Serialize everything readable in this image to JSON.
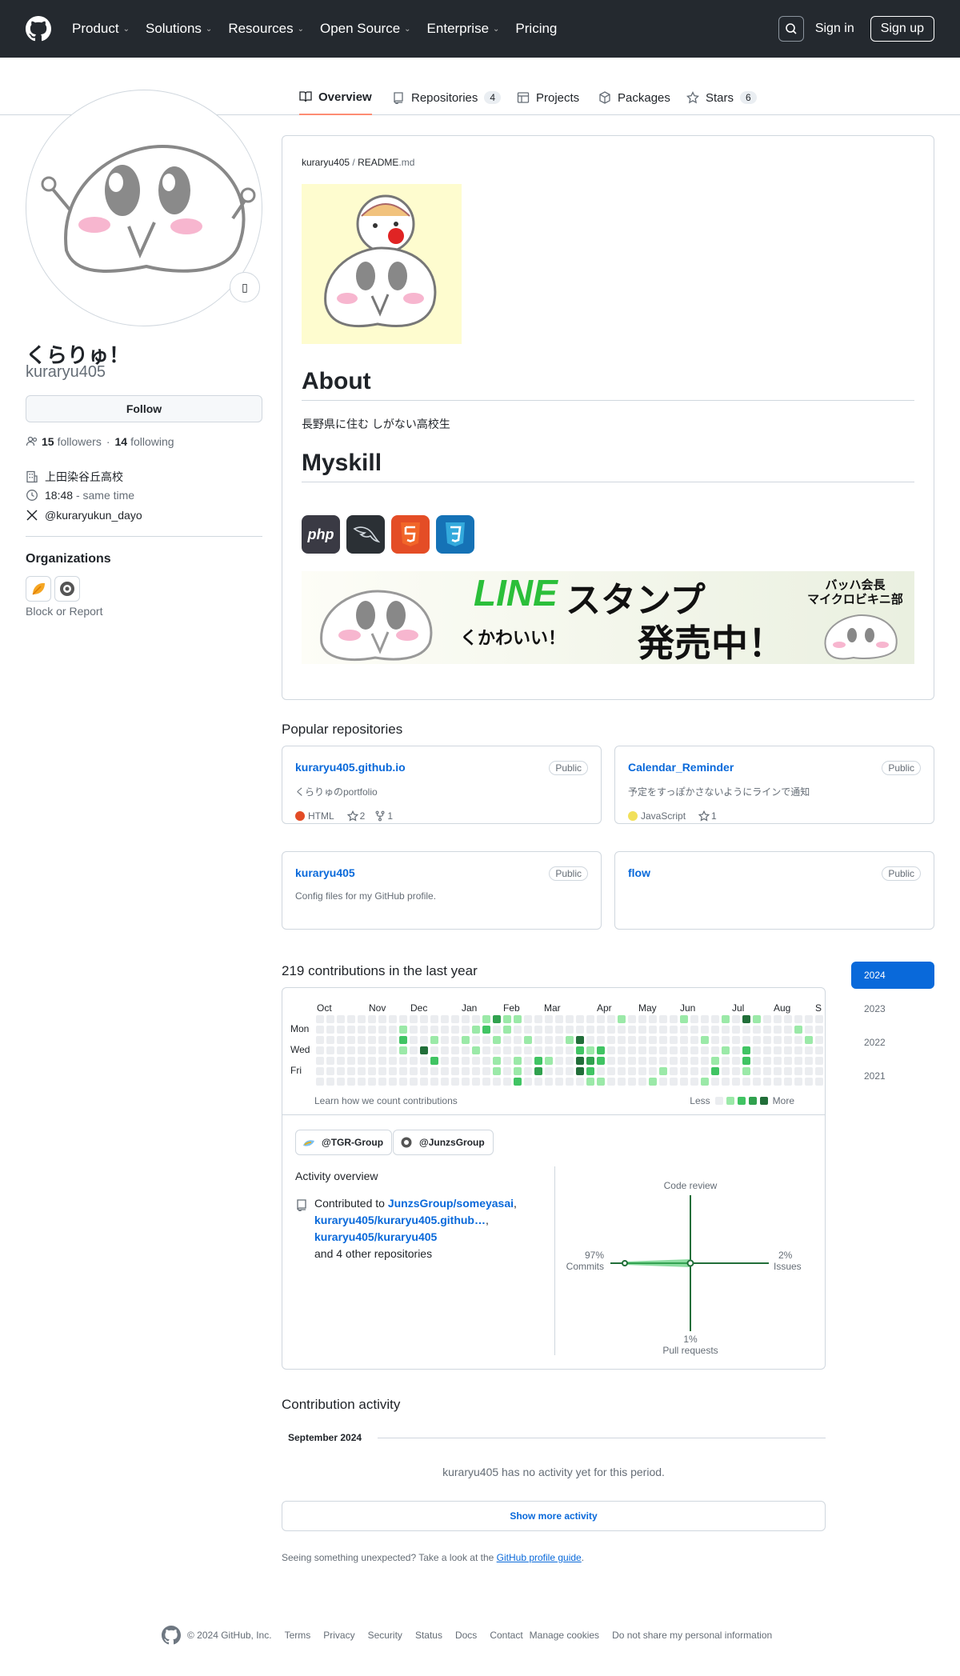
{
  "header": {
    "nav": [
      "Product",
      "Solutions",
      "Resources",
      "Open Source",
      "Enterprise",
      "Pricing"
    ],
    "sign_in": "Sign in",
    "sign_up": "Sign up"
  },
  "tabs": [
    {
      "label": "Overview"
    },
    {
      "label": "Repositories",
      "count": "4"
    },
    {
      "label": "Projects"
    },
    {
      "label": "Packages"
    },
    {
      "label": "Stars",
      "count": "6"
    }
  ],
  "profile": {
    "name": "くらりゅ！",
    "login": "kuraryu405",
    "follow_label": "Follow",
    "followers_count": "15",
    "followers_label": "followers",
    "following_count": "14",
    "following_label": "following",
    "org": "上田染谷丘高校",
    "time": "18:48",
    "time_note": "- same time",
    "twitter": "@kuraryukun_dayo",
    "organizations_heading": "Organizations",
    "block_report": "Block or Report"
  },
  "readme": {
    "path_user": "kuraryu405",
    "path_sep": " / ",
    "path_file": "README",
    "path_ext": ".md",
    "about_heading": "About",
    "about_text": "長野県に住む しがない高校生",
    "skill_heading": "Myskill",
    "skills": [
      "php",
      "mysql-icon",
      "html5-icon",
      "css3-icon"
    ],
    "banner": {
      "line": "LINE",
      "stamp": "スタンプ",
      "cute": "くかわいい！",
      "sale": "発売中！",
      "author1": "バッハ会長",
      "author2": "マイクロビキニ部"
    }
  },
  "popular": {
    "heading": "Popular repositories",
    "repos": [
      {
        "name": "kuraryu405.github.io",
        "visibility": "Public",
        "desc": "くらりゅのportfolio",
        "lang": "HTML",
        "lang_color": "#e34c26",
        "stars": "2",
        "forks": "1"
      },
      {
        "name": "Calendar_Reminder",
        "visibility": "Public",
        "desc": "予定をすっぽかさないようにラインで通知",
        "lang": "JavaScript",
        "lang_color": "#f1e05a",
        "stars": "1"
      },
      {
        "name": "kuraryu405",
        "visibility": "Public",
        "desc": "Config files for my GitHub profile."
      },
      {
        "name": "flow",
        "visibility": "Public",
        "desc": ""
      }
    ]
  },
  "contributions": {
    "heading": "219 contributions in the last year",
    "months": [
      "Oct",
      "Nov",
      "Dec",
      "Jan",
      "Feb",
      "Mar",
      "Apr",
      "May",
      "Jun",
      "Jul",
      "Aug",
      "S"
    ],
    "days": [
      "Mon",
      "Wed",
      "Fri"
    ],
    "learn": "Learn how we count contributions",
    "less": "Less",
    "more": "More",
    "colors": [
      "#ebedf0",
      "#9be9a8",
      "#40c463",
      "#30a14e",
      "#216e39"
    ],
    "years": [
      "2024",
      "2023",
      "2022",
      "2021"
    ],
    "selected_year": "2024"
  },
  "activity": {
    "groups": [
      "@TGR-Group",
      "@JunzsGroup"
    ],
    "overview_heading": "Activity overview",
    "contributed_to": "Contributed to",
    "repo1": "JunzsGroup/someyasai",
    "repo2": "kuraryu405/kuraryu405.github…",
    "repo3": "kuraryu405/kuraryu405",
    "others": "and 4 other repositories",
    "code_review": "Code review",
    "commits_pct": "97%",
    "commits": "Commits",
    "issues_pct": "2%",
    "issues": "Issues",
    "pr_pct": "1%",
    "pull_requests": "Pull requests"
  },
  "contribution_activity": {
    "heading": "Contribution activity",
    "month": "September 2024",
    "no_activity": "kuraryu405 has no activity yet for this period.",
    "show_more": "Show more activity",
    "guide_prefix": "Seeing something unexpected? Take a look at the",
    "guide_link": "GitHub profile guide",
    "guide_suffix": "."
  },
  "footer": {
    "copyright": "© 2024 GitHub, Inc.",
    "links": [
      "Terms",
      "Privacy",
      "Security",
      "Status",
      "Docs",
      "Contact",
      "Manage cookies",
      "Do not share my personal information"
    ]
  }
}
